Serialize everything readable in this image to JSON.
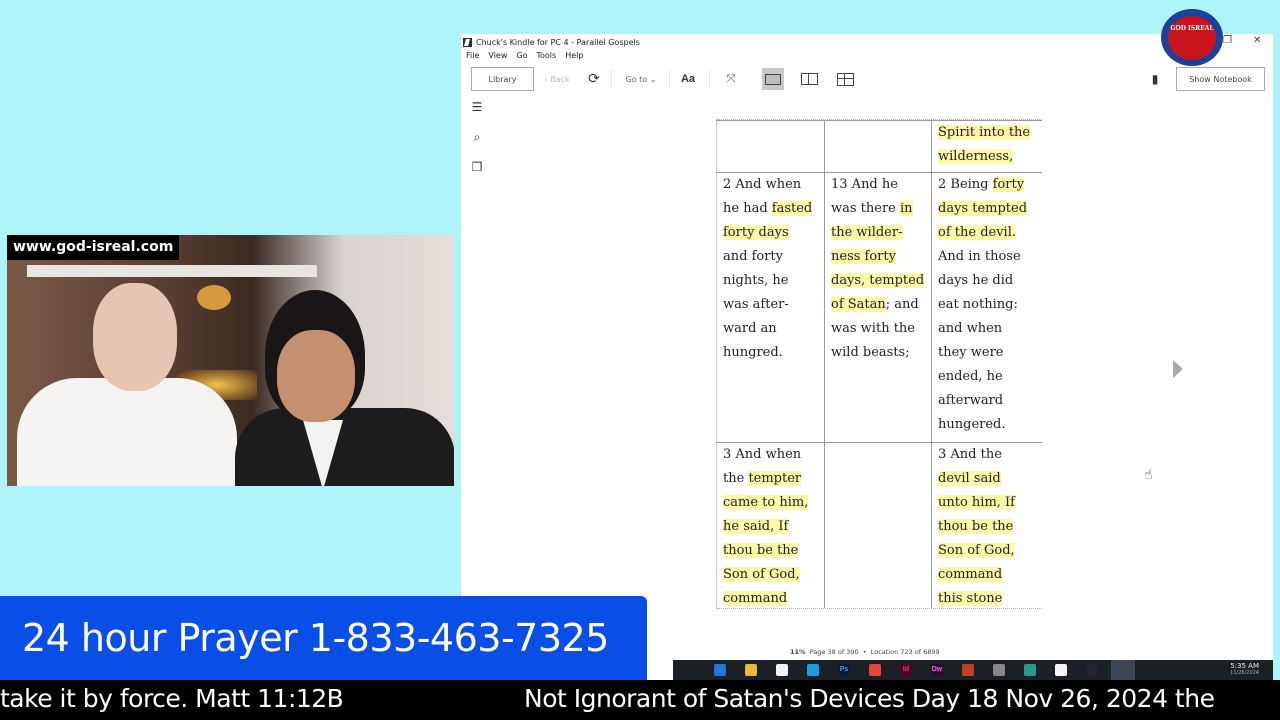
{
  "window": {
    "title": "Chuck's Kindle for PC 4 - Parallel Gospels",
    "menu": [
      "File",
      "View",
      "Go",
      "Tools",
      "Help"
    ],
    "controls": {
      "restore": "❐",
      "close": "✕"
    }
  },
  "toolbar": {
    "library": "Library",
    "back": "‹ Back",
    "sync_icon": "⟳",
    "goto": "Go to ⌄",
    "font": "Aa",
    "fullscreen_icon": "⤧",
    "bookmark_icon": "🔖",
    "show_notebook": "Show Notebook",
    "view_modes": [
      "single-page",
      "two-page",
      "fit-grid"
    ],
    "active_view": "single-page"
  },
  "side_icons": [
    "table-of-contents-icon",
    "search-icon",
    "flashcards-icon"
  ],
  "book": {
    "rows": [
      {
        "cells": [
          [],
          [],
          [
            [
              {
                "t": "Spirit into the",
                "h": true
              }
            ],
            [
              {
                "t": "wilderness,",
                "h": true
              }
            ]
          ]
        ]
      },
      {
        "cells": [
          [
            [
              {
                "t": "2 And when",
                "h": false
              }
            ],
            [
              {
                "t": "he had ",
                "h": false
              },
              {
                "t": "fasted",
                "h": true
              }
            ],
            [
              {
                "t": "forty days",
                "h": true
              }
            ],
            [
              {
                "t": "and forty",
                "h": false
              }
            ],
            [
              {
                "t": "nights, he",
                "h": false
              }
            ],
            [
              {
                "t": "was after-",
                "h": false
              }
            ],
            [
              {
                "t": "ward an",
                "h": false
              }
            ],
            [
              {
                "t": "hungred.",
                "h": false
              }
            ]
          ],
          [
            [
              {
                "t": "13 And he",
                "h": false
              }
            ],
            [
              {
                "t": "was there ",
                "h": false
              },
              {
                "t": "in",
                "h": true
              }
            ],
            [
              {
                "t": "the wilder-",
                "h": true
              }
            ],
            [
              {
                "t": "ness forty",
                "h": true
              }
            ],
            [
              {
                "t": "days, tempted",
                "h": true
              }
            ],
            [
              {
                "t": "of Satan",
                "h": true
              },
              {
                "t": "; and",
                "h": false
              }
            ],
            [
              {
                "t": "was with the",
                "h": false
              }
            ],
            [
              {
                "t": "wild beasts;",
                "h": false
              }
            ]
          ],
          [
            [
              {
                "t": "2 Being ",
                "h": false
              },
              {
                "t": "forty",
                "h": true
              }
            ],
            [
              {
                "t": "days tempted",
                "h": true
              }
            ],
            [
              {
                "t": "of the devil.",
                "h": true
              }
            ],
            [
              {
                "t": "And in those",
                "h": false
              }
            ],
            [
              {
                "t": "days he did",
                "h": false
              }
            ],
            [
              {
                "t": "eat nothing:",
                "h": false
              }
            ],
            [
              {
                "t": "and when",
                "h": false
              }
            ],
            [
              {
                "t": "they were",
                "h": false
              }
            ],
            [
              {
                "t": "ended, he",
                "h": false
              }
            ],
            [
              {
                "t": "afterward",
                "h": false
              }
            ],
            [
              {
                "t": "hungered.",
                "h": false
              }
            ]
          ]
        ]
      },
      {
        "cells": [
          [
            [
              {
                "t": "3 And when",
                "h": false
              }
            ],
            [
              {
                "t": "the ",
                "h": false
              },
              {
                "t": "tempter",
                "h": true
              }
            ],
            [
              {
                "t": "came to him,",
                "h": true
              }
            ],
            [
              {
                "t": "he said, If",
                "h": true
              }
            ],
            [
              {
                "t": "thou be the",
                "h": true
              }
            ],
            [
              {
                "t": "Son of God,",
                "h": true
              }
            ],
            [
              {
                "t": "command",
                "h": true
              }
            ]
          ],
          [],
          [
            [
              {
                "t": "3 And the",
                "h": false
              }
            ],
            [
              {
                "t": "devil said",
                "h": true
              }
            ],
            [
              {
                "t": "unto him, If",
                "h": true
              }
            ],
            [
              {
                "t": "thou be the",
                "h": true
              }
            ],
            [
              {
                "t": "Son of God,",
                "h": true
              }
            ],
            [
              {
                "t": "command",
                "h": true
              }
            ],
            [
              {
                "t": "this stone",
                "h": true
              }
            ]
          ]
        ]
      }
    ]
  },
  "status": {
    "percent": "11%",
    "page": "Page 38 of 390",
    "separator": "•",
    "location": "Location 723 of 6899"
  },
  "taskbar": {
    "apps": [
      "task-view",
      "mail",
      "file-explorer",
      "store",
      "edge",
      "photoshop",
      "chrome",
      "indesign",
      "dreamweaver",
      "app-red",
      "app-usb",
      "app-bird",
      "capcut",
      "app-monitor",
      "kindle"
    ],
    "labels": {
      "photoshop": "Ps",
      "indesign": "Id",
      "dreamweaver": "Dw"
    },
    "time": "5:35 AM",
    "date": "11/26/2024"
  },
  "overlay": {
    "logo_text": "GOD ISREAL",
    "website": "www.god-isreal.com",
    "prayer_line": "24 hour Prayer 1-833-463-7325",
    "ticker_left": "take it by force. Matt 11:12B",
    "ticker_right": "Not Ignorant of Satan's Devices Day 18 Nov 26, 2024 the"
  }
}
